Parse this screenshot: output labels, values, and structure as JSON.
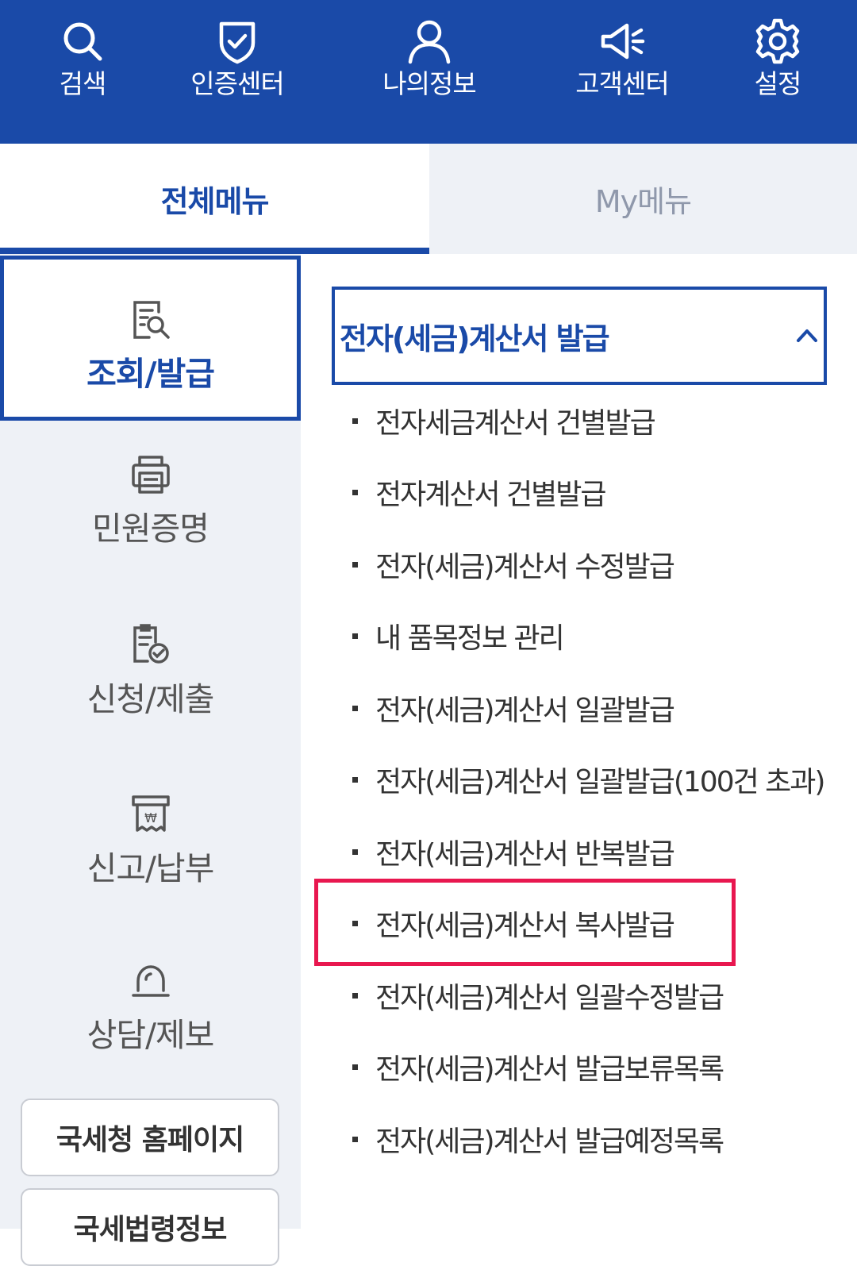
{
  "topbar": {
    "items": [
      {
        "label": "검색",
        "icon": "search-icon"
      },
      {
        "label": "인증센터",
        "icon": "shield-check-icon"
      },
      {
        "label": "나의정보",
        "icon": "user-icon"
      },
      {
        "label": "고객센터",
        "icon": "megaphone-icon"
      },
      {
        "label": "설정",
        "icon": "gear-icon"
      }
    ]
  },
  "tabs": {
    "all_menu": "전체메뉴",
    "my_menu": "My메뉴",
    "active": "all_menu"
  },
  "categories": [
    {
      "label": "조회/발급",
      "icon": "document-search-icon",
      "active": true
    },
    {
      "label": "민원증명",
      "icon": "printer-icon",
      "active": false
    },
    {
      "label": "신청/제출",
      "icon": "document-check-icon",
      "active": false
    },
    {
      "label": "신고/납부",
      "icon": "won-receipt-icon",
      "active": false
    },
    {
      "label": "상담/제보",
      "icon": "bell-icon",
      "active": false
    }
  ],
  "side_buttons": {
    "nts_homepage": "국세청 홈페이지",
    "tax_law_info": "국세법령정보"
  },
  "submenu": {
    "group_title": "전자(세금)계산서 발급",
    "expanded": true,
    "items": [
      "전자세금계산서 건별발급",
      "전자계산서 건별발급",
      "전자(세금)계산서 수정발급",
      "내 품목정보 관리",
      "전자(세금)계산서 일괄발급",
      "전자(세금)계산서 일괄발급(100건 초과)",
      "전자(세금)계산서 반복발급",
      "전자(세금)계산서 복사발급",
      "전자(세금)계산서 일괄수정발급",
      "전자(세금)계산서 발급보류목록",
      "전자(세금)계산서 발급예정목록"
    ],
    "highlighted_item": "전자(세금)계산서 복사발급"
  },
  "colors": {
    "brand_blue": "#1a4aa8",
    "highlight_red": "#e8174f",
    "sidebar_bg": "#eef1f6"
  }
}
